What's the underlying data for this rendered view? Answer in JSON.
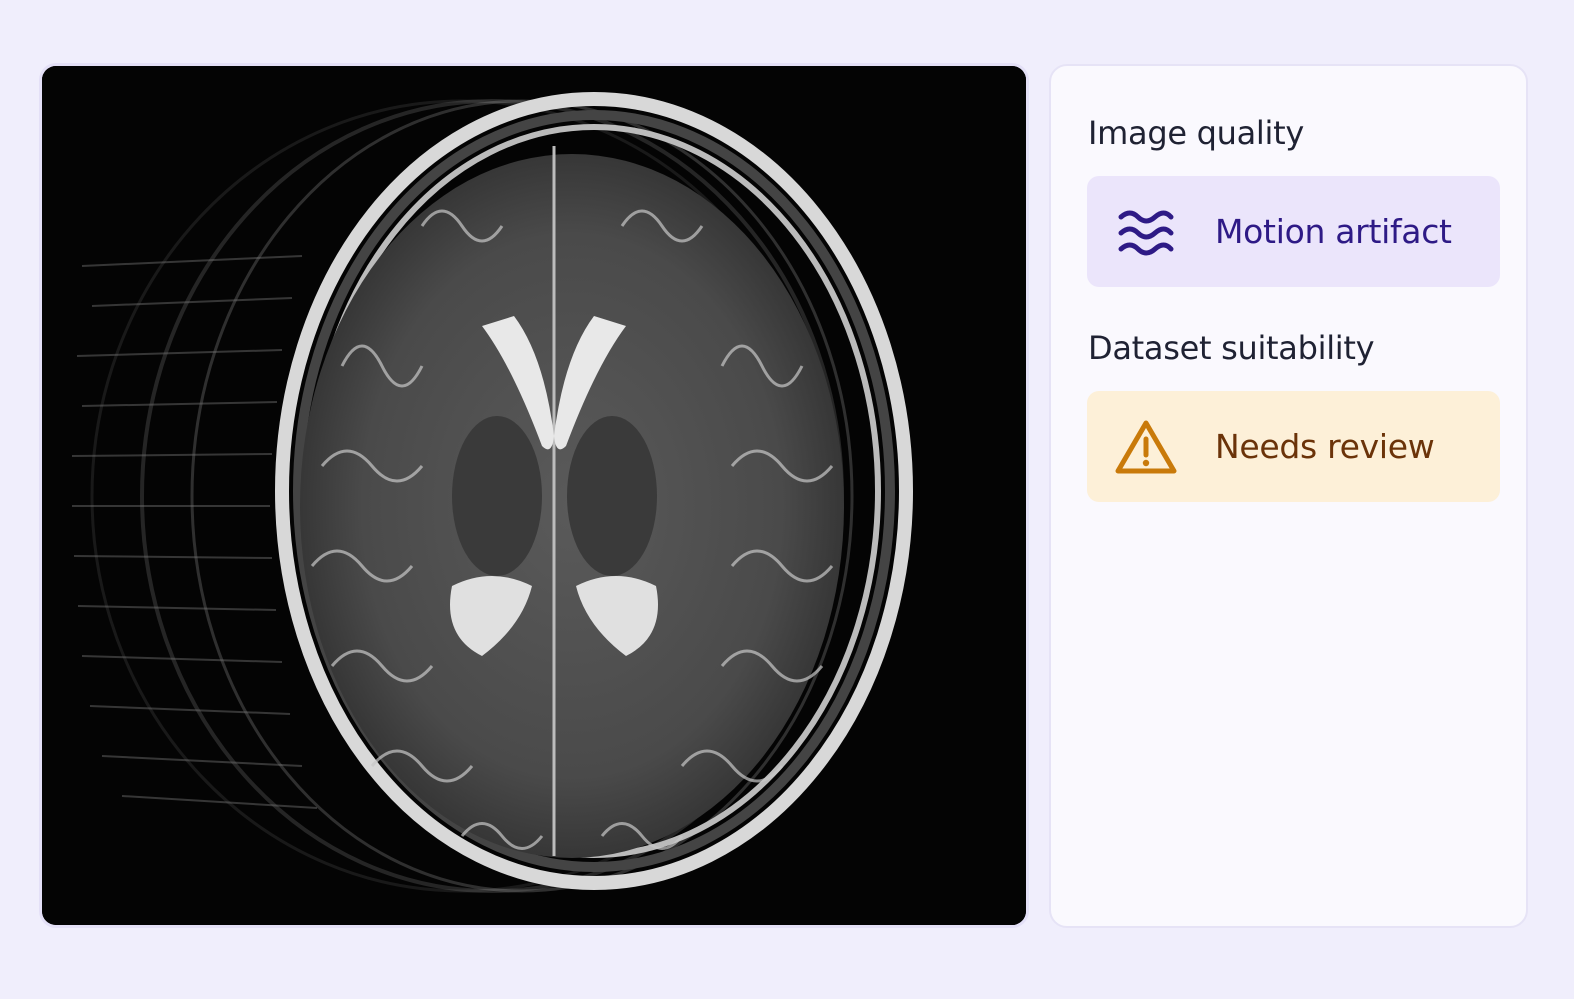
{
  "scan": {
    "description_name": "axial-brain-mri"
  },
  "panel": {
    "image_quality": {
      "title": "Image quality",
      "status_label": "Motion artifact",
      "icon": "waves-icon",
      "color": "#2e1a86",
      "background": "#ebe5fb"
    },
    "dataset_suitability": {
      "title": "Dataset suitability",
      "status_label": "Needs review",
      "icon": "warning-icon",
      "color": "#c97a0a",
      "background": "#fdf0d8"
    }
  }
}
